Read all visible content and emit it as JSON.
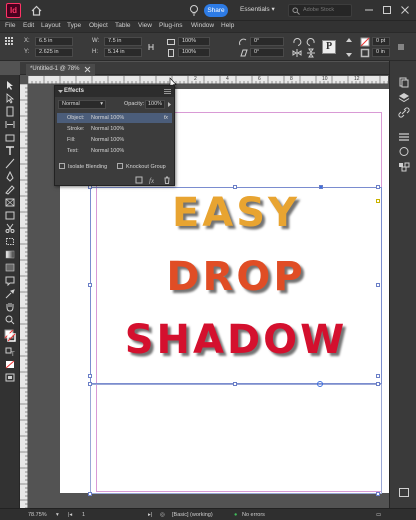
{
  "app": {
    "logo": "Id",
    "share_label": "Share",
    "workspace": "Essentials",
    "search_placeholder": "Adobe Stock"
  },
  "menu": [
    "File",
    "Edit",
    "Layout",
    "Type",
    "Object",
    "Table",
    "View",
    "Plug-ins",
    "Window",
    "Help"
  ],
  "control_bar": {
    "x_label": "X:",
    "x_value": "6.5 in",
    "y_label": "Y:",
    "y_value": "2.625 in",
    "w_label": "W:",
    "w_value": "7.5 in",
    "h_label": "H:",
    "h_value": "5.14 in",
    "scale_x": "100%",
    "scale_y": "100%",
    "rotate": "0°",
    "shear": "0°",
    "stroke_weight": "0 pt",
    "frame_value": "0 in",
    "pct_right": "100%"
  },
  "document_tab": {
    "title": "*Untitled-1 @ 78%"
  },
  "ruler_labels": [
    "2",
    "4",
    "6",
    "8",
    "10",
    "12"
  ],
  "effects_panel": {
    "title": "Effects",
    "blend_mode": "Normal",
    "opacity_label": "Opacity:",
    "opacity_value": "100%",
    "rows": [
      {
        "key": "Object:",
        "value": "Normal 100%",
        "selected": true
      },
      {
        "key": "Stroke:",
        "value": "Normal 100%",
        "selected": false
      },
      {
        "key": "Fill:",
        "value": "Normal 100%",
        "selected": false
      },
      {
        "key": "Text:",
        "value": "Normal 100%",
        "selected": false
      }
    ],
    "isolate_label": "Isolate Blending",
    "knockout_label": "Knockout Group"
  },
  "artwork": {
    "line1": "EASY",
    "line2": "DROP",
    "line3": "SHADOW",
    "colors": {
      "line1": "#e8a431",
      "line2": "#e04d25",
      "line3": "#d4102e"
    }
  },
  "status_bar": {
    "zoom": "78.75%",
    "page": "1",
    "style": "[Basic] (working)",
    "preflight": "No errors"
  }
}
